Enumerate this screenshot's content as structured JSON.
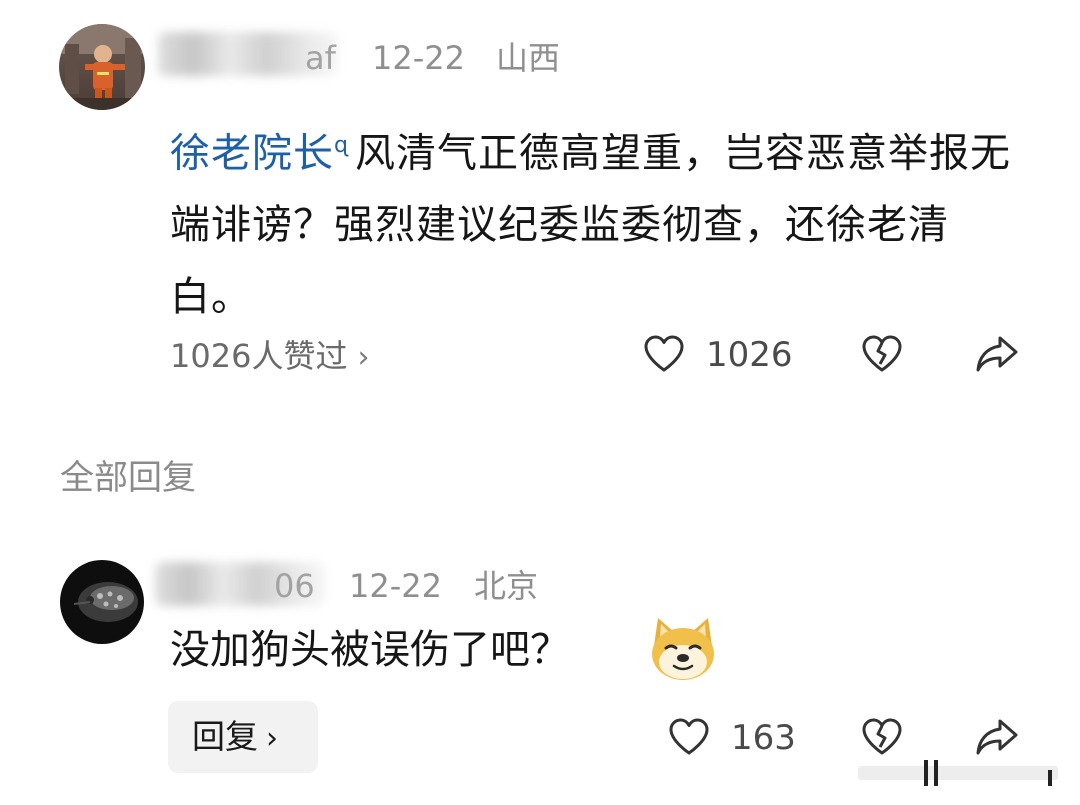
{
  "comment": {
    "username_tail": "af",
    "date": "12-22",
    "location": "山西",
    "mention": "徐老院长",
    "text": "风清气正德高望重，岂容恶意举报无端诽谤？强烈建议纪委监委彻查，还徐老清白。",
    "likers_text": "1026人赞过",
    "like_count": "1026"
  },
  "replies_section": {
    "title": "全部回复"
  },
  "reply": {
    "username_tail": "06",
    "date": "12-22",
    "location": "北京",
    "text": "没加狗头被误伤了吧？",
    "emoji": "doge-emoji",
    "like_count": "163",
    "reply_button_label": "回复"
  },
  "icons": {
    "like": "heart-icon",
    "dislike": "broken-heart-icon",
    "share": "share-arrow-icon",
    "chevron": "chevron-right-icon"
  },
  "colors": {
    "mention": "#1d5fa8",
    "meta": "#8f8f8f",
    "button_bg": "#f2f2f2"
  }
}
